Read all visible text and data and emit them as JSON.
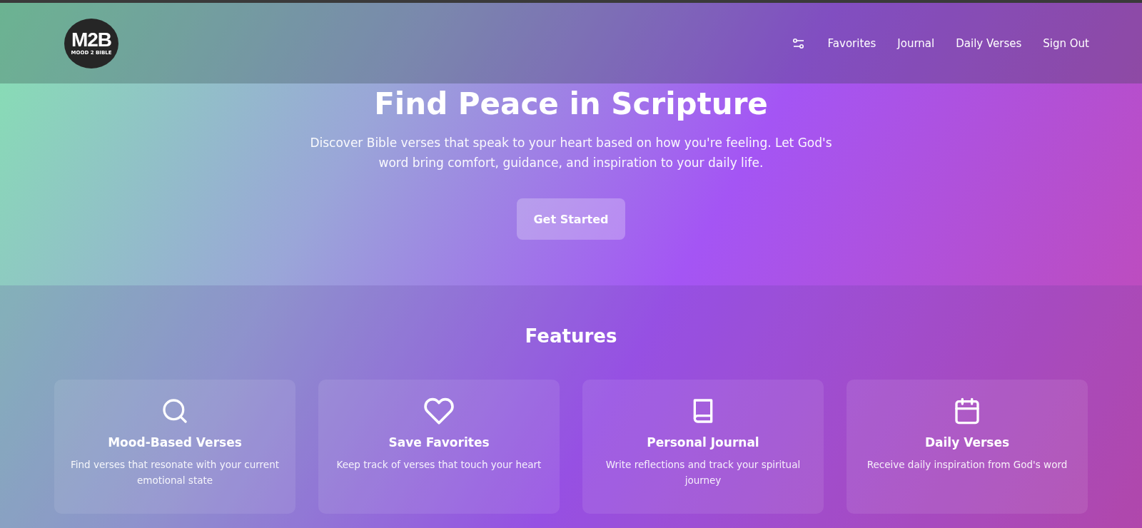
{
  "header": {
    "logo": {
      "mark": "M2B",
      "tagline": "MOOD 2 BIBLE"
    },
    "nav": [
      "Favorites",
      "Journal",
      "Daily Verses",
      "Sign Out"
    ]
  },
  "hero": {
    "title": "Find Peace in Scripture",
    "subtitle": "Discover Bible verses that speak to your heart based on how you're feeling. Let God's word bring comfort, guidance, and inspiration to your daily life.",
    "button": "Get Started"
  },
  "features": {
    "heading": "Features",
    "cards": [
      {
        "kind": "search",
        "title": "Mood-Based Verses",
        "text": "Find verses that resonate with your current emotional state"
      },
      {
        "kind": "heart",
        "title": "Save Favorites",
        "text": "Keep track of verses that touch your heart"
      },
      {
        "kind": "book",
        "title": "Personal Journal",
        "text": "Write reflections and track your spiritual journey"
      },
      {
        "kind": "calendar",
        "title": "Daily Verses",
        "text": "Receive daily inspiration from God's word"
      }
    ]
  }
}
